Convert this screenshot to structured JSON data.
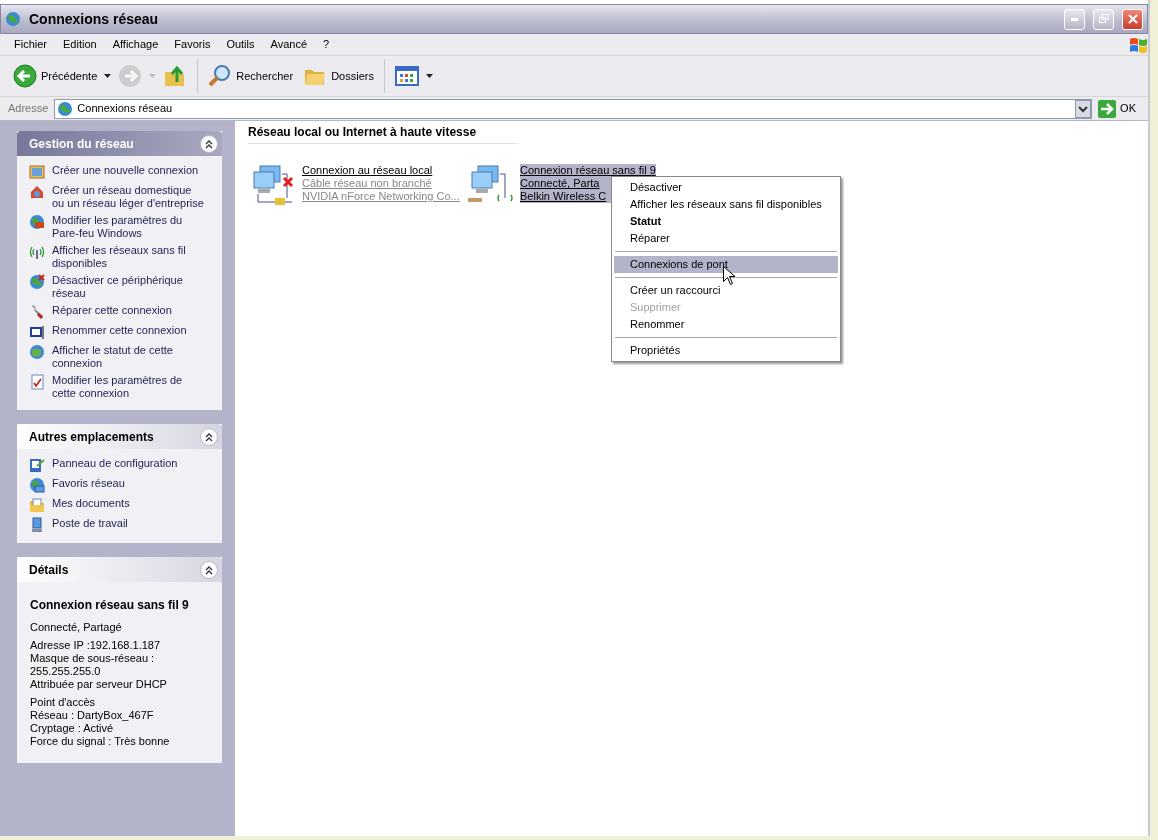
{
  "window": {
    "title": "Connexions réseau"
  },
  "menu_bar": [
    "Fichier",
    "Edition",
    "Affichage",
    "Favoris",
    "Outils",
    "Avancé",
    "?"
  ],
  "toolbar": [
    {
      "kind": "back",
      "label": "Précédente",
      "disabled": false,
      "dropdown": true
    },
    {
      "kind": "forward",
      "disabled": true,
      "dropdown": true
    },
    {
      "kind": "up"
    },
    {
      "kind": "separator"
    },
    {
      "kind": "search",
      "label": "Rechercher"
    },
    {
      "kind": "folders",
      "label": "Dossiers"
    },
    {
      "kind": "separator"
    },
    {
      "kind": "views",
      "dropdown": true
    }
  ],
  "address_bar": {
    "label": "Adresse",
    "value": "Connexions réseau",
    "go_label": "OK"
  },
  "sidebar": {
    "panels": [
      {
        "kind": "primary",
        "title": "Gestion du réseau",
        "expanded": true,
        "items": [
          {
            "lines": [
              "Créer une nouvelle connexion"
            ]
          },
          {
            "lines": [
              "Créer un réseau domestique",
              "ou un réseau léger d'entreprise"
            ]
          },
          {
            "lines": [
              "Modifier les paramètres du",
              "Pare-feu Windows"
            ]
          },
          {
            "lines": [
              "Afficher les réseaux sans fil",
              "disponibles"
            ]
          },
          {
            "lines": [
              "Désactiver ce périphérique",
              "réseau"
            ]
          },
          {
            "lines": [
              "Réparer cette connexion"
            ]
          },
          {
            "lines": [
              "Renommer cette connexion"
            ]
          },
          {
            "lines": [
              "Afficher le statut de cette",
              "connexion"
            ]
          },
          {
            "lines": [
              "Modifier les paramètres de",
              "cette connexion"
            ]
          }
        ]
      },
      {
        "kind": "normal",
        "title": "Autres emplacements",
        "expanded": true,
        "items": [
          {
            "lines": [
              "Panneau de configuration"
            ]
          },
          {
            "lines": [
              "Favoris réseau"
            ]
          },
          {
            "lines": [
              "Mes documents"
            ]
          },
          {
            "lines": [
              "Poste de travail"
            ]
          }
        ]
      },
      {
        "kind": "details",
        "title": "Détails",
        "expanded": true,
        "heading": "Connexion réseau sans fil 9",
        "groups": [
          [
            "Connecté, Partagé"
          ],
          [
            "Adresse IP :192.168.1.187",
            "Masque de sous-réseau :",
            "255.255.255.0",
            "Attribuée par serveur DHCP"
          ],
          [
            "Point d'accès",
            "Réseau : DartyBox_467F",
            "Cryptage : Activé",
            "Force du signal : Très bonne"
          ]
        ]
      }
    ]
  },
  "content": {
    "group_title": "Réseau local ou Internet à haute vitesse",
    "connections": [
      {
        "kind": "wired",
        "selected": false,
        "connected": false,
        "name": "Connexion au réseau local",
        "status": "Câble réseau non branché",
        "device": "NVIDIA nForce Networking Co..."
      },
      {
        "kind": "wireless",
        "selected": true,
        "connected": true,
        "name": "Connexion réseau sans fil 9",
        "status": "Connecté, Parta",
        "device": "Belkin Wireless C"
      }
    ]
  },
  "context_menu": [
    {
      "kind": "item",
      "label": "Désactiver",
      "bold": false,
      "disabled": false,
      "selected": false
    },
    {
      "kind": "item",
      "label": "Afficher les réseaux sans fil disponibles",
      "bold": false,
      "disabled": false,
      "selected": false
    },
    {
      "kind": "item",
      "label": "Statut",
      "bold": true,
      "disabled": false,
      "selected": false
    },
    {
      "kind": "item",
      "label": "Réparer",
      "bold": false,
      "disabled": false,
      "selected": false
    },
    {
      "kind": "separator"
    },
    {
      "kind": "item",
      "label": "Connexions de pont",
      "bold": false,
      "disabled": false,
      "selected": true
    },
    {
      "kind": "separator"
    },
    {
      "kind": "item",
      "label": "Créer un raccourci",
      "bold": false,
      "disabled": false,
      "selected": false
    },
    {
      "kind": "item",
      "label": "Supprimer",
      "bold": false,
      "disabled": true,
      "selected": false
    },
    {
      "kind": "item",
      "label": "Renommer",
      "bold": false,
      "disabled": false,
      "selected": false
    },
    {
      "kind": "separator"
    },
    {
      "kind": "item",
      "label": "Propriétés",
      "bold": false,
      "disabled": false,
      "selected": false
    }
  ]
}
